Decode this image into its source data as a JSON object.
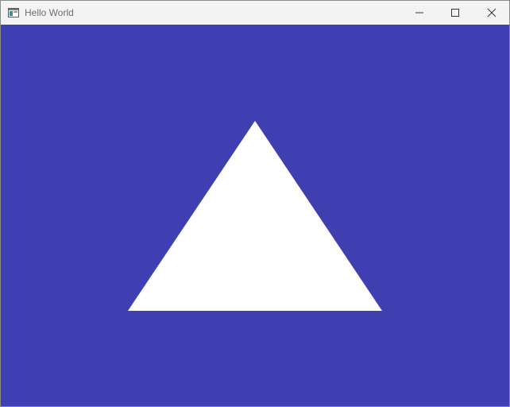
{
  "window": {
    "title": "Hello World",
    "app_icon": "window-app-icon",
    "controls": {
      "minimize_icon": "minimize-icon",
      "maximize_icon": "maximize-icon",
      "close_icon": "close-icon"
    }
  },
  "viewport": {
    "background_color": "#3f3fb1",
    "shape": "triangle",
    "shape_color": "#ffffff"
  }
}
